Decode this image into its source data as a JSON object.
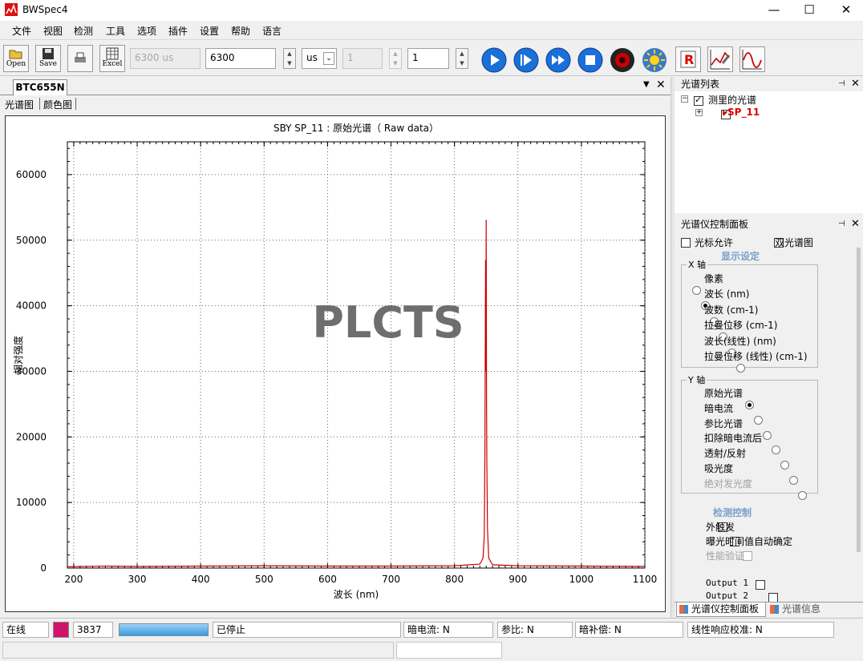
{
  "window": {
    "title": "BWSpec4"
  },
  "menu": [
    "文件",
    "视图",
    "检测",
    "工具",
    "选项",
    "插件",
    "设置",
    "帮助",
    "语言"
  ],
  "toolbar": {
    "open_label": "Open",
    "save_label": "Save",
    "excel_label": "Excel",
    "integration_display": "6300 us",
    "integration_value": "6300",
    "unit_value": "us",
    "average_display": "1",
    "average_value": "1"
  },
  "doc": {
    "tab": "BTC655N",
    "subtabs": [
      "光谱图",
      "颜色图"
    ]
  },
  "chart_data": {
    "type": "line",
    "title": "SBY  SP_11 : 原始光谱（ Raw data）",
    "xlabel": "波长 (nm)",
    "ylabel": "相对强度",
    "xlim": [
      190,
      1100
    ],
    "ylim": [
      0,
      65000
    ],
    "xticks": [
      200,
      300,
      400,
      500,
      600,
      700,
      800,
      900,
      1000,
      1100
    ],
    "yticks": [
      0,
      10000,
      20000,
      30000,
      40000,
      50000,
      60000
    ],
    "grid": true,
    "watermark": "PLCTS",
    "series_color": "#cc0000",
    "peak": {
      "x": 850,
      "y": 53000
    },
    "x": [
      190,
      250,
      300,
      400,
      500,
      600,
      700,
      800,
      840,
      845,
      847,
      848,
      849,
      849.5,
      850,
      850.5,
      851,
      852,
      854,
      860,
      900,
      1000,
      1100
    ],
    "y": [
      200,
      300,
      250,
      300,
      350,
      300,
      300,
      350,
      600,
      1500,
      5000,
      18000,
      47000,
      30000,
      53000,
      26000,
      16000,
      6000,
      1500,
      500,
      350,
      300,
      250
    ]
  },
  "spectrum_list": {
    "title": "光谱列表",
    "root": "测里的光谱",
    "item": "SP_11"
  },
  "control_panel": {
    "title": "光谱仪控制面板",
    "cursor_label": "光标允许",
    "dual_label": "双光谱图",
    "display_settings": "显示设定",
    "x_axis": {
      "title": "X 轴",
      "options": [
        "像素",
        "波长 (nm)",
        "波数 (cm-1)",
        "拉曼位移 (cm-1)",
        "波长(线性) (nm)",
        "拉曼位移 (线性) (cm-1)"
      ],
      "selected": 1
    },
    "y_axis": {
      "title": "Y 轴",
      "options": [
        "原始光谱",
        "暗电流",
        "参比光谱",
        "扣除暗电流后",
        "透射/反射",
        "吸光度",
        "绝对发光度"
      ],
      "selected": 0
    },
    "detect_control": "检测控制",
    "detect_options": [
      "外触发",
      "曝光时间值自动确定",
      "性能验证"
    ],
    "outputs": [
      "Output 1",
      "Output 2"
    ]
  },
  "bottom_tabs": [
    "光谱仪控制面板",
    "光谱信息"
  ],
  "status": {
    "online": "在线",
    "swatch_color": "#d0146a",
    "count": "3837",
    "progress": 1.0,
    "state": "已停止",
    "dark": "暗电流: N",
    "ref": "参比: N",
    "dark_comp": "暗补偿: N",
    "linearity": "线性响应校准: N"
  }
}
